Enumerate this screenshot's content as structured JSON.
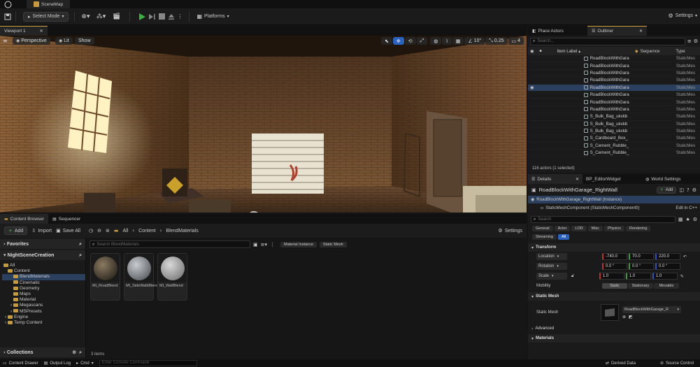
{
  "window": {
    "title": "SceneMap"
  },
  "toolbar": {
    "select_mode": "Select Mode",
    "platforms": "Platforms",
    "settings": "Settings"
  },
  "viewport": {
    "tab": "Viewport 1",
    "perspective": "Perspective",
    "lit": "Lit",
    "show": "Show",
    "angle_snap": "10°",
    "scale_snap": "0.25",
    "camera_speed": "4"
  },
  "content_browser": {
    "tabs": [
      "Content Browser",
      "Sequencer"
    ],
    "add": "Add",
    "import": "Import",
    "save_all": "Save All",
    "breadcrumb": [
      "All",
      "Content",
      "BlendMaterials"
    ],
    "settings": "Settings",
    "favorites": "Favorites",
    "project": "NightSceneCreation",
    "tree": [
      {
        "label": "All",
        "level": 0
      },
      {
        "label": "Content",
        "level": 1
      },
      {
        "label": "BlendMaterials",
        "level": 2,
        "selected": true
      },
      {
        "label": "Cinematic",
        "level": 2
      },
      {
        "label": "Geometry",
        "level": 2
      },
      {
        "label": "Maps",
        "level": 2
      },
      {
        "label": "Material",
        "level": 2
      },
      {
        "label": "Megascans",
        "level": 2
      },
      {
        "label": "MSPresets",
        "level": 2
      },
      {
        "label": "Engine",
        "level": 1
      },
      {
        "label": "Temp Content",
        "level": 1
      }
    ],
    "collections": "Collections",
    "search_placeholder": "Search BlendMaterials",
    "filters": [
      "Material Instance",
      "Static Mesh"
    ],
    "assets": [
      {
        "name": "MI_RoadBlend"
      },
      {
        "name": "MI_SideWalkBlend"
      },
      {
        "name": "MI_WallBlend"
      }
    ],
    "item_count": "3 items"
  },
  "status_bar": {
    "content_drawer": "Content Drawer",
    "output_log": "Output Log",
    "cmd": "Cmd",
    "console_placeholder": "Enter Console Command",
    "derived_data": "Derived Data",
    "source_control": "Source Control"
  },
  "outliner": {
    "tabs": [
      "Place Actors",
      "Outliner"
    ],
    "search_placeholder": "Search...",
    "columns": [
      "Item Label",
      "Sequence",
      "Type"
    ],
    "rows": [
      {
        "label": "RoadBlockWithGara",
        "type": "StaticMes"
      },
      {
        "label": "RoadBlockWithGara",
        "type": "StaticMes"
      },
      {
        "label": "RoadBlockWithGara",
        "type": "StaticMes"
      },
      {
        "label": "RoadBlockWithGara",
        "type": "StaticMes"
      },
      {
        "label": "RoadBlockWithGara",
        "type": "StaticMes",
        "selected": true
      },
      {
        "label": "RoadBlockWithGara",
        "type": "StaticMes"
      },
      {
        "label": "RoadBlockWithGara",
        "type": "StaticMes"
      },
      {
        "label": "RoadBlockWithGara",
        "type": "StaticMes"
      },
      {
        "label": "S_Bulk_Bag_ukxkb",
        "type": "StaticMes"
      },
      {
        "label": "S_Bulk_Bag_ukxkb",
        "type": "StaticMes"
      },
      {
        "label": "S_Bulk_Bag_ukxkb",
        "type": "StaticMes"
      },
      {
        "label": "S_Cardboard_Box_",
        "type": "StaticMes"
      },
      {
        "label": "S_Cement_Rubble_",
        "type": "StaticMes"
      },
      {
        "label": "S_Cement_Rubble_",
        "type": "StaticMes"
      }
    ],
    "count": "116 actors (1 selected)"
  },
  "details": {
    "tabs": [
      "Details",
      "BP_EditorWidget",
      "World Settings"
    ],
    "actor_name": "RoadBlockWithGarage_RightWall",
    "add": "Add",
    "instance": "RoadBlockWithGarage_RightWall (Instance)",
    "component": "StaticMeshComponent (StaticMeshComponent0)",
    "edit_link": "Edit in C++",
    "search_placeholder": "Search",
    "filters_row1": [
      "General",
      "Actor",
      "LOD",
      "Misc",
      "Physics",
      "Rendering"
    ],
    "filters_row2": [
      "Streaming",
      "All"
    ],
    "transform_header": "Transform",
    "location": {
      "label": "Location",
      "x": "-740.0",
      "y": "70.0",
      "z": "220.0"
    },
    "rotation": {
      "label": "Rotation",
      "x": "0.0 °",
      "y": "0.0 °",
      "z": "0.0 °"
    },
    "scale": {
      "label": "Scale",
      "x": "1.0",
      "y": "1.0",
      "z": "1.0"
    },
    "mobility": {
      "label": "Mobility",
      "options": [
        "Static",
        "Stationary",
        "Movable"
      ]
    },
    "static_mesh_header": "Static Mesh",
    "static_mesh_label": "Static Mesh",
    "static_mesh_value": "RoadBlockWithGarage_R",
    "advanced": "Advanced",
    "materials_header": "Materials"
  },
  "colors": {
    "accent": "#2b3f5e",
    "play_green": "#3cb043",
    "folder": "#c89a3c",
    "x_axis": "#c03030",
    "y_axis": "#3c9a3c",
    "z_axis": "#3050c0"
  }
}
